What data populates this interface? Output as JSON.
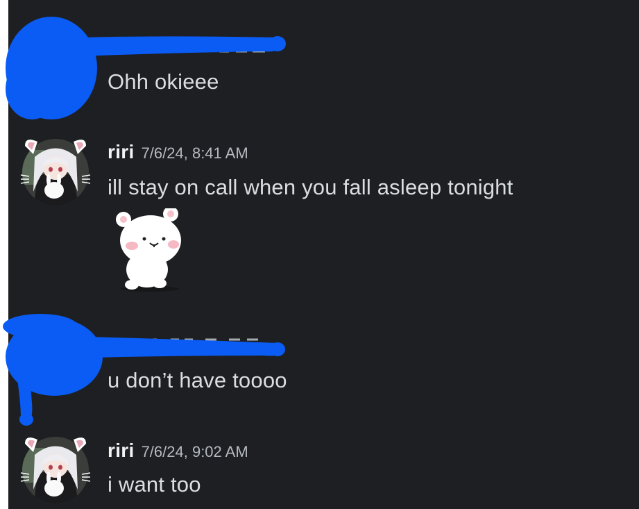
{
  "messages": [
    {
      "author": "",
      "timestamp": "",
      "text": "Ohh okieee"
    },
    {
      "author": "riri",
      "timestamp": "7/6/24, 8:41 AM",
      "text": "ill stay on call when you fall asleep tonight",
      "sticker": "white-bear-sticker"
    },
    {
      "author": "",
      "timestamp": "",
      "text": "u don’t have toooo"
    },
    {
      "author": "riri",
      "timestamp": "7/6/24, 9:02 AM",
      "text": "i want too"
    }
  ],
  "colors": {
    "background": "#1e1f22",
    "username": "#f2f3f5",
    "timestamp": "#b5bac1",
    "message_text": "#dbdee1",
    "redaction": "#0a5cf5"
  },
  "icons": {
    "avatar": "anime-girl-with-cat-ears-avatar",
    "sticker": "white-bear-sticker"
  }
}
